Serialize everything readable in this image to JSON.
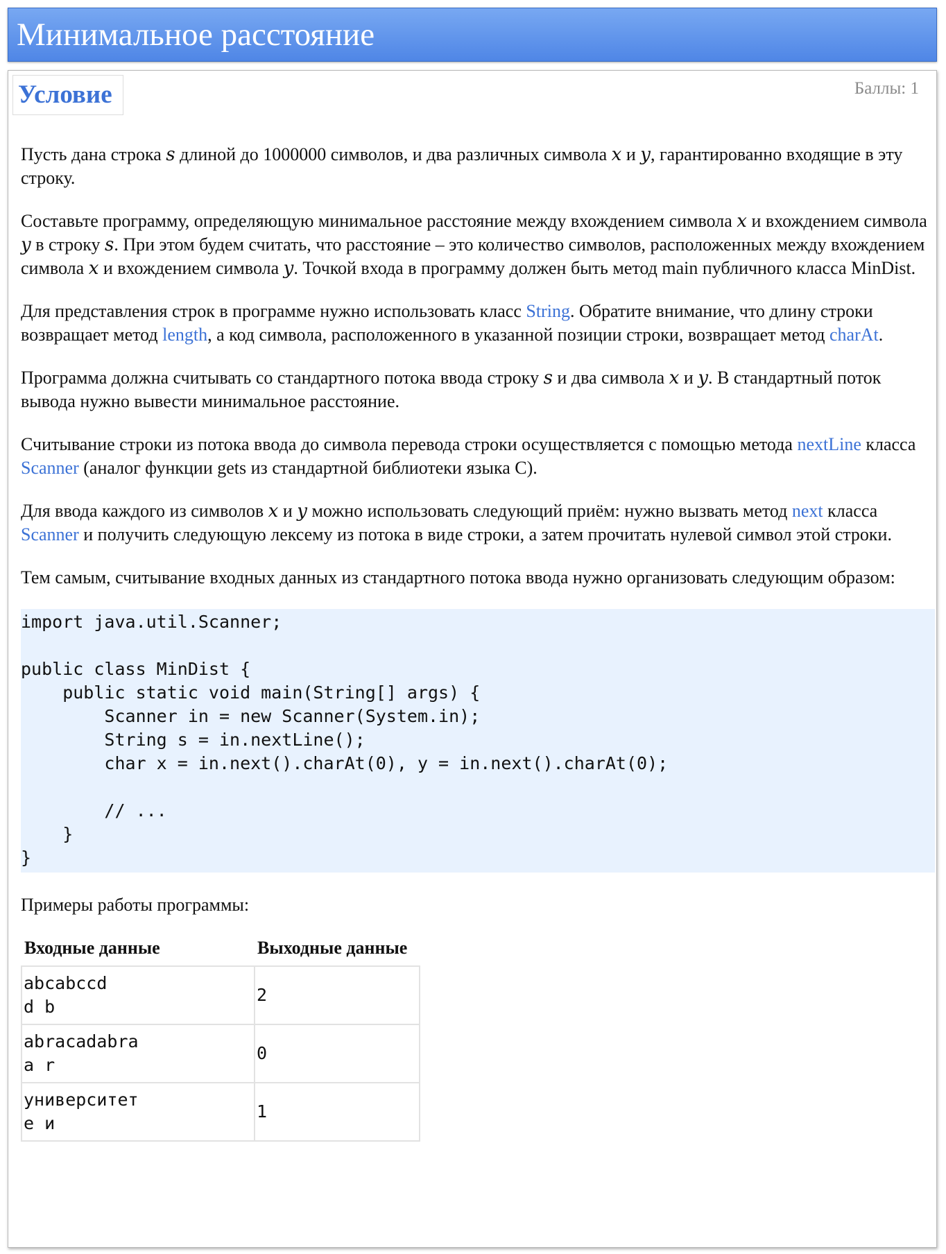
{
  "header": {
    "title": "Минимальное расстояние"
  },
  "tab": {
    "label": "Условие"
  },
  "points": "Баллы: 1",
  "paragraphs": {
    "p1": {
      "a": "Пусть дана строка ",
      "s": "s",
      "b": " длиной до 1000000 символов, и два различных символа ",
      "x": "x",
      "c": " и ",
      "y": "y",
      "d": ", гарантированно входящие в эту строку."
    },
    "p2": {
      "a": "Составьте программу, определяющую минимальное расстояние между вхождением символа ",
      "x1": "x",
      "b": " и вхождением символа ",
      "y1": "y",
      "c": " в строку ",
      "s": "s",
      "d": ". При этом будем считать, что расстояние – это количество символов, расположенных между вхождением символа ",
      "x2": "x",
      "e": " и вхождением символа ",
      "y2": "y",
      "f": ". Точкой входа в программу должен быть метод main публичного класса MinDist."
    },
    "p3": {
      "a": "Для представления строк в программе нужно использовать класс ",
      "link1": "String",
      "b": ". Обратите внимание, что длину строки возвращает метод ",
      "link2": "length",
      "c": ", а код символа, расположенного в указанной позиции строки, возвращает метод ",
      "link3": "charAt",
      "d": "."
    },
    "p4": {
      "a": "Программа должна считывать со стандартного потока ввода строку ",
      "s": "s",
      "b": " и два символа ",
      "x": "x",
      "c": " и ",
      "y": "y",
      "d": ". В стандартный поток вывода нужно вывести минимальное расстояние."
    },
    "p5": {
      "a": "Считывание строки из потока ввода до символа перевода строки осуществляется с помощью метода ",
      "link1": "nextLine",
      "b": " класса ",
      "link2": "Scanner",
      "c": " (аналог функции gets из стандартной библиотеки языка C)."
    },
    "p6": {
      "a": "Для ввода каждого из символов ",
      "x": "x",
      "b": " и ",
      "y": "y",
      "c": " можно использовать следующий приём: нужно вызвать метод ",
      "link1": "next",
      "d": " класса ",
      "link2": "Scanner",
      "e": " и получить следующую лексему из потока в виде строки, а затем прочитать нулевой символ этой строки."
    },
    "p7": "Тем самым, считывание входных данных из стандартного потока ввода нужно организовать следующим образом:"
  },
  "code": "import java.util.Scanner;\n\npublic class MinDist {\n    public static void main(String[] args) {\n        Scanner in = new Scanner(System.in);\n        String s = in.nextLine();\n        char x = in.next().charAt(0), y = in.next().charAt(0);\n\n        // ...\n    }\n}",
  "examples_label": "Примеры работы программы:",
  "examples": {
    "headers": {
      "input": "Входные данные",
      "output": "Выходные данные"
    },
    "rows": [
      {
        "input": "abcabccd\nd b",
        "output": "2"
      },
      {
        "input": "abracadabra\na r",
        "output": "0"
      },
      {
        "input": "университет\nе и",
        "output": "1"
      }
    ]
  }
}
